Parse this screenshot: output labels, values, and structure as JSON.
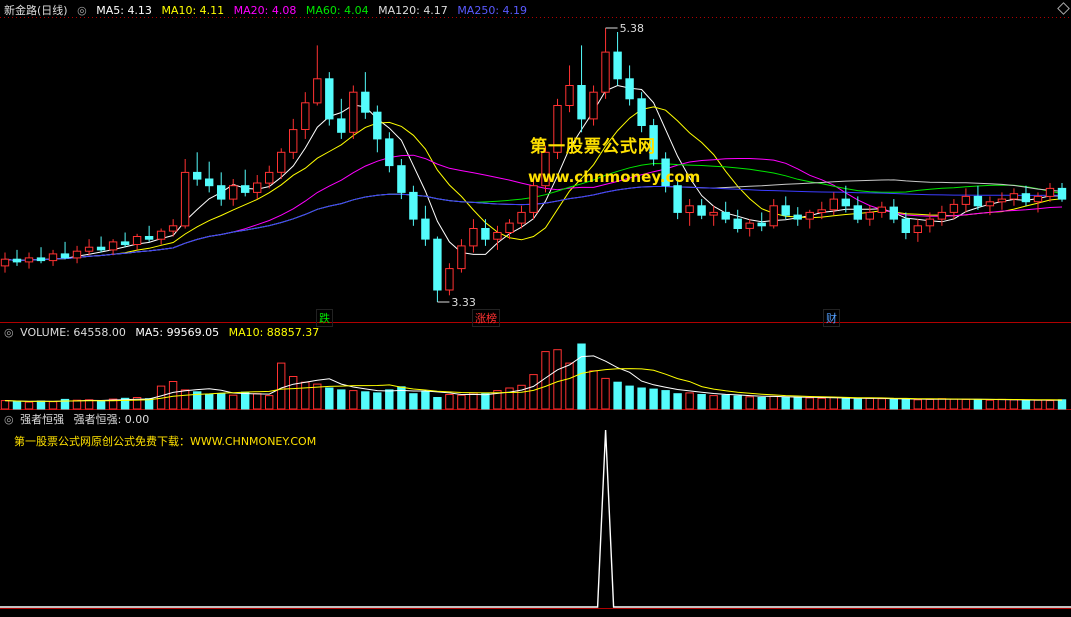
{
  "colors": {
    "up": "#ff3232",
    "down": "#54fcfc",
    "ma5": "#ffffff",
    "ma10": "#ffff00",
    "ma20": "#ff00ff",
    "ma60": "#00e600",
    "ma120": "#c8c8c8",
    "ma250": "#3c3cff",
    "grid": "#b00000",
    "indicator": "#ffffff"
  },
  "main": {
    "stock_name": "新金路(日线)",
    "ma5": {
      "label": "MA5:",
      "value": "4.13"
    },
    "ma10": {
      "label": "MA10:",
      "value": "4.11"
    },
    "ma20": {
      "label": "MA20:",
      "value": "4.08"
    },
    "ma60": {
      "label": "MA60:",
      "value": "4.04"
    },
    "ma120": {
      "label": "MA120:",
      "value": "4.17"
    },
    "ma250": {
      "label": "MA250:",
      "value": "4.19"
    },
    "high_label": "5.38",
    "low_label": "3.33",
    "watermark_cn": "第一股票公式网",
    "watermark_url": "www.chnmoney.com",
    "tags": [
      {
        "text": "跌",
        "color": "#00e600"
      },
      {
        "text": "涨榜",
        "color": "#ff3232"
      },
      {
        "text": "财",
        "color": "#54a0ff"
      }
    ]
  },
  "volume": {
    "title": "VOLUME: 64558.00",
    "ma5": "MA5: 99569.05",
    "ma10": "MA10: 88857.37"
  },
  "indicator": {
    "name": "强者恒强",
    "label": "强者恒强: 0.00",
    "note": "第一股票公式网原创公式免费下载：WWW.CHNMONEY.COM"
  },
  "chart_data": {
    "type": "candlestick",
    "candles_ohlc": [
      [
        3.6,
        3.7,
        3.55,
        3.65
      ],
      [
        3.65,
        3.72,
        3.6,
        3.63
      ],
      [
        3.63,
        3.7,
        3.58,
        3.66
      ],
      [
        3.66,
        3.74,
        3.62,
        3.64
      ],
      [
        3.64,
        3.72,
        3.6,
        3.69
      ],
      [
        3.69,
        3.78,
        3.65,
        3.66
      ],
      [
        3.66,
        3.75,
        3.62,
        3.71
      ],
      [
        3.71,
        3.8,
        3.68,
        3.74
      ],
      [
        3.74,
        3.82,
        3.7,
        3.72
      ],
      [
        3.72,
        3.8,
        3.68,
        3.78
      ],
      [
        3.78,
        3.85,
        3.74,
        3.76
      ],
      [
        3.76,
        3.84,
        3.72,
        3.82
      ],
      [
        3.82,
        3.9,
        3.78,
        3.8
      ],
      [
        3.8,
        3.88,
        3.76,
        3.86
      ],
      [
        3.86,
        3.95,
        3.82,
        3.9
      ],
      [
        3.9,
        4.4,
        3.88,
        4.3
      ],
      [
        4.3,
        4.45,
        4.2,
        4.25
      ],
      [
        4.25,
        4.38,
        4.15,
        4.2
      ],
      [
        4.2,
        4.3,
        4.05,
        4.1
      ],
      [
        4.1,
        4.25,
        4.05,
        4.2
      ],
      [
        4.2,
        4.32,
        4.12,
        4.15
      ],
      [
        4.15,
        4.28,
        4.1,
        4.22
      ],
      [
        4.22,
        4.35,
        4.18,
        4.3
      ],
      [
        4.3,
        4.48,
        4.25,
        4.45
      ],
      [
        4.45,
        4.7,
        4.4,
        4.62
      ],
      [
        4.62,
        4.9,
        4.55,
        4.82
      ],
      [
        4.82,
        5.25,
        4.8,
        5.0
      ],
      [
        5.0,
        5.05,
        4.65,
        4.7
      ],
      [
        4.7,
        4.85,
        4.55,
        4.6
      ],
      [
        4.6,
        4.95,
        4.55,
        4.9
      ],
      [
        4.9,
        5.05,
        4.7,
        4.75
      ],
      [
        4.75,
        4.8,
        4.45,
        4.55
      ],
      [
        4.55,
        4.6,
        4.3,
        4.35
      ],
      [
        4.35,
        4.4,
        4.1,
        4.15
      ],
      [
        4.15,
        4.2,
        3.9,
        3.95
      ],
      [
        3.95,
        4.05,
        3.75,
        3.8
      ],
      [
        3.8,
        3.82,
        3.33,
        3.42
      ],
      [
        3.42,
        3.62,
        3.38,
        3.58
      ],
      [
        3.58,
        3.8,
        3.55,
        3.75
      ],
      [
        3.75,
        3.95,
        3.7,
        3.88
      ],
      [
        3.88,
        3.95,
        3.75,
        3.8
      ],
      [
        3.8,
        3.9,
        3.72,
        3.85
      ],
      [
        3.85,
        3.95,
        3.8,
        3.92
      ],
      [
        3.92,
        4.05,
        3.88,
        4.0
      ],
      [
        4.0,
        4.25,
        3.95,
        4.2
      ],
      [
        4.2,
        4.5,
        4.15,
        4.45
      ],
      [
        4.45,
        4.85,
        4.4,
        4.8
      ],
      [
        4.8,
        5.1,
        4.75,
        4.95
      ],
      [
        4.95,
        5.25,
        4.6,
        4.7
      ],
      [
        4.7,
        4.95,
        4.65,
        4.9
      ],
      [
        4.9,
        5.38,
        4.85,
        5.2
      ],
      [
        5.2,
        5.35,
        4.95,
        5.0
      ],
      [
        5.0,
        5.1,
        4.8,
        4.85
      ],
      [
        4.85,
        4.9,
        4.6,
        4.65
      ],
      [
        4.65,
        4.7,
        4.35,
        4.4
      ],
      [
        4.4,
        4.45,
        4.15,
        4.2
      ],
      [
        4.2,
        4.25,
        3.95,
        4.0
      ],
      [
        4.0,
        4.1,
        3.9,
        4.05
      ],
      [
        4.05,
        4.1,
        3.95,
        3.98
      ],
      [
        3.98,
        4.05,
        3.9,
        4.0
      ],
      [
        4.0,
        4.08,
        3.92,
        3.95
      ],
      [
        3.95,
        4.02,
        3.85,
        3.88
      ],
      [
        3.88,
        3.95,
        3.82,
        3.92
      ],
      [
        3.92,
        4.0,
        3.86,
        3.9
      ],
      [
        3.9,
        4.1,
        3.88,
        4.05
      ],
      [
        4.05,
        4.12,
        3.95,
        3.98
      ],
      [
        3.98,
        4.04,
        3.9,
        3.95
      ],
      [
        3.95,
        4.02,
        3.88,
        4.0
      ],
      [
        4.0,
        4.08,
        3.95,
        4.02
      ],
      [
        4.02,
        4.15,
        3.98,
        4.1
      ],
      [
        4.1,
        4.2,
        4.0,
        4.05
      ],
      [
        4.05,
        4.12,
        3.92,
        3.95
      ],
      [
        3.95,
        4.05,
        3.9,
        4.0
      ],
      [
        4.0,
        4.08,
        3.96,
        4.04
      ],
      [
        4.04,
        4.1,
        3.92,
        3.95
      ],
      [
        3.95,
        4.0,
        3.8,
        3.85
      ],
      [
        3.85,
        3.95,
        3.78,
        3.9
      ],
      [
        3.9,
        4.0,
        3.85,
        3.95
      ],
      [
        3.95,
        4.05,
        3.9,
        4.0
      ],
      [
        4.0,
        4.1,
        3.95,
        4.06
      ],
      [
        4.06,
        4.18,
        4.0,
        4.12
      ],
      [
        4.12,
        4.2,
        4.02,
        4.05
      ],
      [
        4.05,
        4.12,
        3.98,
        4.08
      ],
      [
        4.08,
        4.15,
        4.02,
        4.1
      ],
      [
        4.1,
        4.18,
        4.05,
        4.14
      ],
      [
        4.14,
        4.2,
        4.05,
        4.08
      ],
      [
        4.08,
        4.15,
        4.0,
        4.12
      ],
      [
        4.12,
        4.22,
        4.08,
        4.18
      ],
      [
        4.18,
        4.22,
        4.08,
        4.1
      ]
    ],
    "volumes": [
      22,
      20,
      18,
      21,
      19,
      25,
      23,
      24,
      20,
      26,
      28,
      30,
      27,
      60,
      72,
      50,
      45,
      38,
      40,
      36,
      44,
      40,
      35,
      120,
      85,
      70,
      65,
      55,
      50,
      48,
      45,
      42,
      50,
      58,
      40,
      45,
      30,
      38,
      36,
      42,
      40,
      48,
      55,
      62,
      90,
      150,
      155,
      120,
      170,
      100,
      80,
      70,
      60,
      55,
      52,
      48,
      40,
      42,
      38,
      35,
      36,
      34,
      32,
      30,
      33,
      31,
      30,
      29,
      28,
      30,
      27,
      26,
      28,
      27,
      25,
      26,
      24,
      25,
      27,
      26,
      25,
      24,
      23,
      25,
      24,
      22,
      23,
      22,
      24
    ],
    "indicator_spike_index": 50,
    "ylim": [
      3.33,
      5.38
    ]
  }
}
